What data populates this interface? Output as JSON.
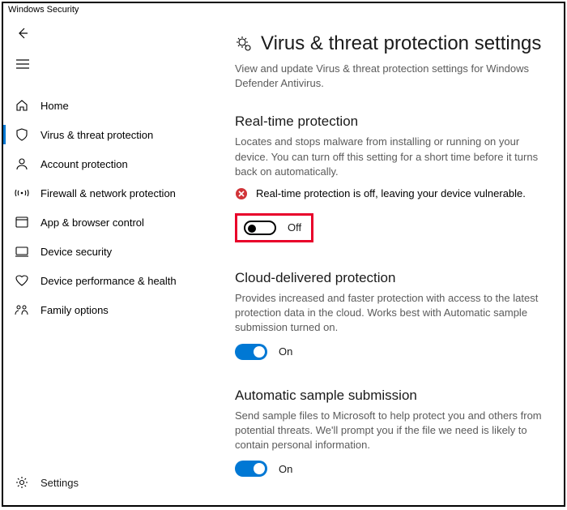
{
  "app_title": "Windows Security",
  "sidebar": {
    "items": [
      {
        "label": "Home"
      },
      {
        "label": "Virus & threat protection"
      },
      {
        "label": "Account protection"
      },
      {
        "label": "Firewall & network protection"
      },
      {
        "label": "App & browser control"
      },
      {
        "label": "Device security"
      },
      {
        "label": "Device performance & health"
      },
      {
        "label": "Family options"
      }
    ],
    "settings_label": "Settings"
  },
  "page": {
    "title": "Virus & threat protection settings",
    "subtitle": "View and update Virus & threat protection settings for Windows Defender Antivirus."
  },
  "sections": {
    "realtime": {
      "title": "Real-time protection",
      "desc": "Locates and stops malware from installing or running on your device. You can turn off this setting for a short time before it turns back on automatically.",
      "warning": "Real-time protection is off, leaving your device vulnerable.",
      "toggle_state": "Off"
    },
    "cloud": {
      "title": "Cloud-delivered protection",
      "desc": "Provides increased and faster protection with access to the latest protection data in the cloud. Works best with Automatic sample submission turned on.",
      "toggle_state": "On"
    },
    "sample": {
      "title": "Automatic sample submission",
      "desc": "Send sample files to Microsoft to help protect you and others from potential threats. We'll prompt you if the file we need is likely to contain personal information.",
      "toggle_state": "On"
    }
  }
}
